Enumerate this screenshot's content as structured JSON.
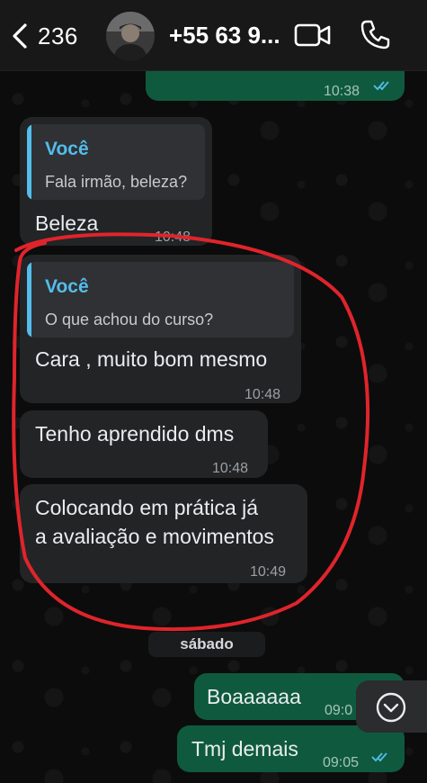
{
  "header": {
    "back_count": "236",
    "contact_name": "+55 63 9...",
    "icons": [
      "back-chevron-icon",
      "video-call-icon",
      "phone-call-icon"
    ]
  },
  "messages": [
    {
      "id": "m0",
      "direction": "out",
      "time": "10:38",
      "status": "read"
    },
    {
      "id": "m1",
      "direction": "in",
      "quote_author": "Você",
      "quote_text": "Fala irmão, beleza?",
      "text": "Beleza",
      "time": "10:48"
    },
    {
      "id": "m2",
      "direction": "in",
      "quote_author": "Você",
      "quote_text": "O que achou do curso?",
      "text": "Cara , muito bom mesmo",
      "time": "10:48"
    },
    {
      "id": "m3",
      "direction": "in",
      "text": "Tenho aprendido dms",
      "time": "10:48"
    },
    {
      "id": "m4",
      "direction": "in",
      "text_line1": "Colocando em prática já",
      "text_line2": "a avaliação e movimentos",
      "time": "10:49"
    },
    {
      "id": "m5",
      "direction": "out",
      "text": "Boaaaaaa",
      "time": "09:0"
    },
    {
      "id": "m6",
      "direction": "out",
      "text": "Tmj demais",
      "time": "09:05",
      "status": "read"
    }
  ],
  "date_separator": "sábado",
  "colors": {
    "incoming_bubble": "#232426",
    "outgoing_bubble": "#0f5a3e",
    "quote_accent": "#53bdeb",
    "read_ticks": "#53bdeb",
    "annotation_red": "#e0242b"
  }
}
